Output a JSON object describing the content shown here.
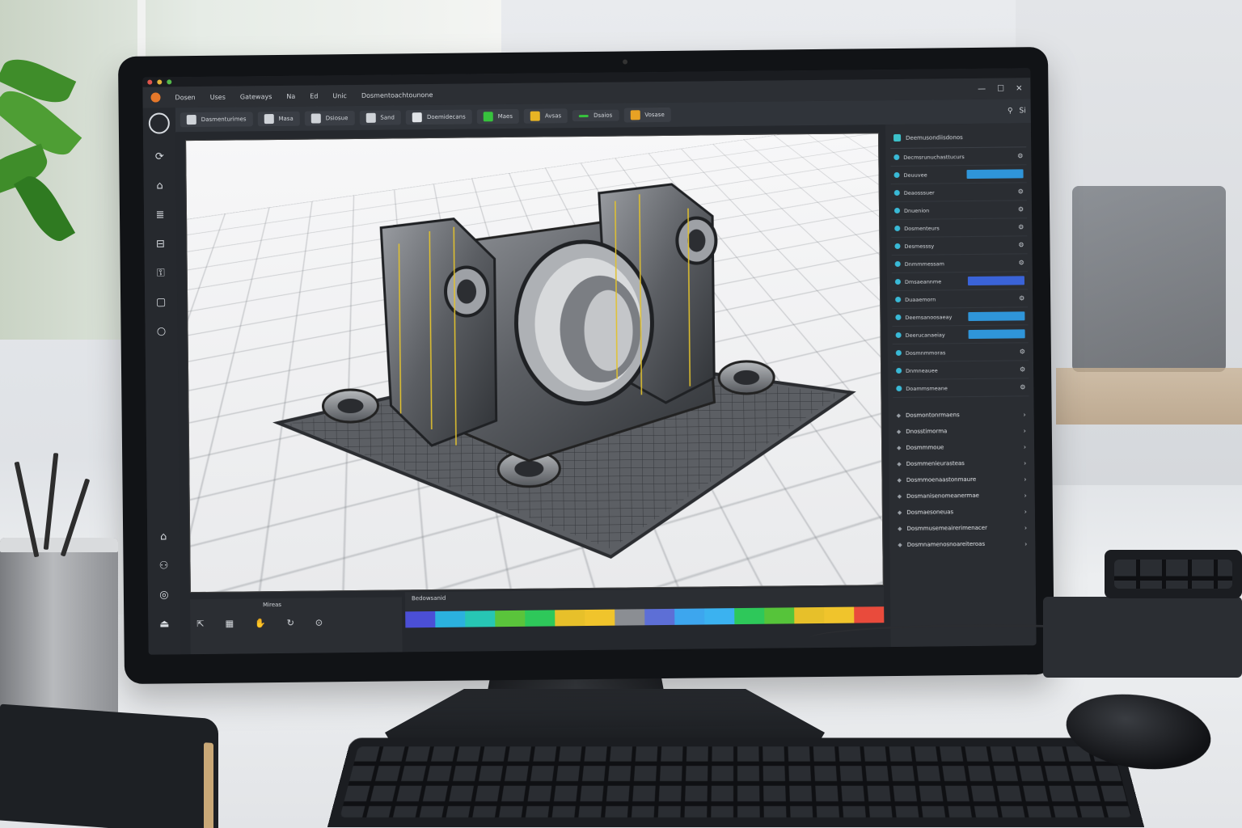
{
  "app": {
    "title": "",
    "accent": "#e6782a",
    "menus": [
      "Dosen",
      "Uses",
      "Gateways",
      "Na",
      "Ed",
      "Unic",
      "Dosmentoachtounone"
    ],
    "window_controls": [
      "minimize-icon",
      "maximize-icon",
      "close-icon"
    ]
  },
  "toolbar": {
    "items": [
      {
        "label": "Dasmenturimes",
        "icon": "sketch-icon",
        "color": "#cfd3d8"
      },
      {
        "label": "Masa",
        "icon": "dimension-icon",
        "color": "#cfd3d8"
      },
      {
        "label": "Dsiosue",
        "icon": "layers-icon",
        "color": "#cfd3d8"
      },
      {
        "label": "Sand",
        "icon": "measure-icon",
        "color": "#cfd3d8"
      },
      {
        "label": "Doemidecans",
        "icon": "cube-icon",
        "color": "#e0e3e7"
      },
      {
        "label": "Maes",
        "icon": "green-square-icon",
        "color": "#37c23d"
      },
      {
        "label": "Avsas",
        "icon": "yellow-square-icon",
        "color": "#e8b524"
      },
      {
        "label": "Dsaios",
        "icon": "green-line-icon",
        "color": "#37c23d"
      },
      {
        "label": "Vosase",
        "icon": "orange-square-icon",
        "color": "#e8a224"
      }
    ],
    "right_label": "Si"
  },
  "left_rail": [
    "orbit-icon",
    "rotate-icon",
    "home-icon",
    "layers-icon",
    "split-icon",
    "lock-icon",
    "wireframe-icon",
    "circle-icon",
    "home-icon",
    "person-icon",
    "snap-icon",
    "measure-icon"
  ],
  "timeline": {
    "label": "Bedowsanid",
    "colors": [
      "#4b4fd6",
      "#2bb1de",
      "#27c6b4",
      "#5ac43b",
      "#2ec85a",
      "#e7c02a",
      "#f0c42c",
      "#8b8e93",
      "#5d6fd6",
      "#3da6ee",
      "#3bb2f0",
      "#2ec85a",
      "#56c43a",
      "#e7c02a",
      "#f0c42c",
      "#e94b3c"
    ]
  },
  "bottom_panel": {
    "title": "Mireas",
    "icons": [
      "cursor-icon",
      "grid-icon",
      "hand-icon",
      "orbit-icon",
      "snap-icon"
    ]
  },
  "right_panel": {
    "title": "Deemusondiisdonos",
    "rows": [
      {
        "label": "Decmsrunuchasttucurs",
        "field": "none"
      },
      {
        "label": "Deuuvee",
        "field": "blue"
      },
      {
        "label": "Deaosssuer",
        "field": "none"
      },
      {
        "label": "Dnuenion",
        "field": "none"
      },
      {
        "label": "Dosmenteurs",
        "field": "none"
      },
      {
        "label": "Desmesssy",
        "field": "none"
      },
      {
        "label": "Dnmmmessam",
        "field": "none"
      },
      {
        "label": "Dmsaeannme",
        "field": "blue2"
      },
      {
        "label": "Duaaemorn",
        "field": "none"
      },
      {
        "label": "Deemsanoosaeay",
        "field": "blue"
      },
      {
        "label": "Deerucanaeiay",
        "field": "blue"
      },
      {
        "label": "Dosmnmmoras",
        "field": "none"
      },
      {
        "label": "Dnmneauee",
        "field": "none"
      },
      {
        "label": "Doammsmeane",
        "field": "none"
      }
    ],
    "subsections": [
      {
        "label": "Dosmontonrmaens"
      },
      {
        "label": "Dnosstimorma"
      },
      {
        "label": "Dosmmmoue"
      },
      {
        "label": "Dosmmenieurasteas"
      },
      {
        "label": "Dosmmoenaastonmaure"
      },
      {
        "label": "Dosmanisenomeanermae"
      },
      {
        "label": "Dosmaesoneuas"
      },
      {
        "label": "Dosmmusemeairerimenacer"
      },
      {
        "label": "Dosmnamenosnoareiteroas"
      }
    ]
  }
}
